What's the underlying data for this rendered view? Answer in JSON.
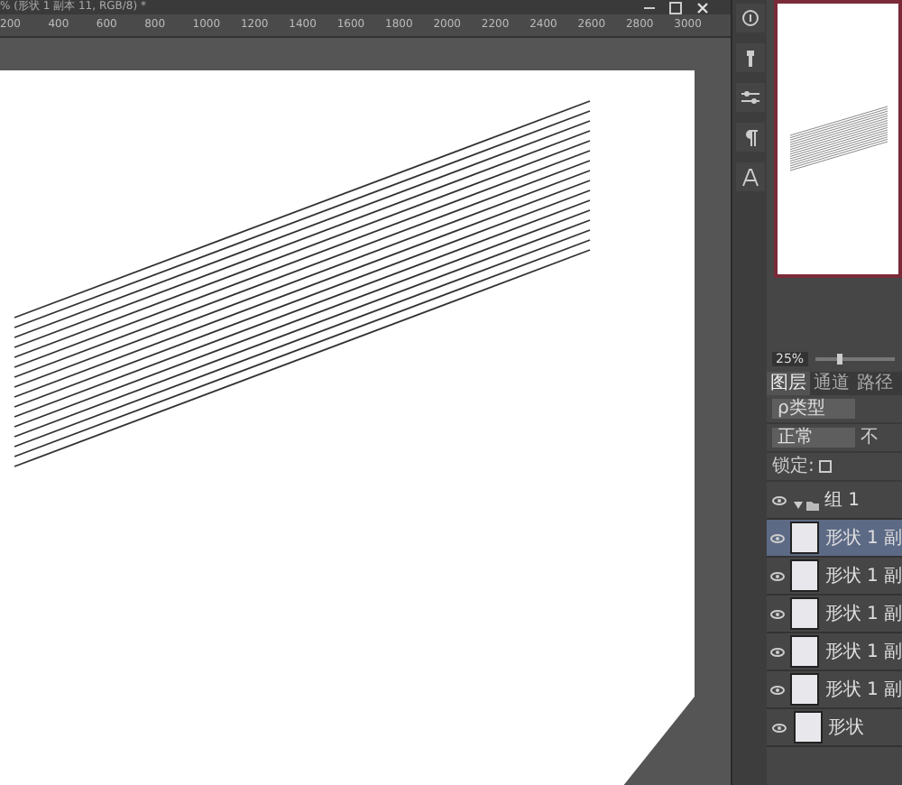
{
  "document": {
    "title": "% (形状 1 副本 11, RGB/8) *",
    "ruler_labels": [
      "200",
      "400",
      "600",
      "800",
      "1000",
      "1200",
      "1400",
      "1600",
      "1800",
      "2000",
      "2200",
      "2400",
      "2600",
      "2800",
      "3000"
    ]
  },
  "navigator": {
    "zoom": "25%",
    "level": 0.3
  },
  "layers_panel": {
    "tabs": [
      {
        "label": "图层",
        "selected": true
      },
      {
        "label": "通道",
        "selected": false
      },
      {
        "label": "路径",
        "selected": false
      }
    ],
    "filter": "ρ类型",
    "blend_mode": "正常",
    "opacity_label": "不",
    "lock_label": "锁定:",
    "layers": [
      {
        "name": "组 1",
        "kind": "group",
        "expanded": true,
        "visible": true,
        "selected": false,
        "children": [
          {
            "name": "形状 1 副",
            "kind": "shape",
            "visible": true,
            "selected": true
          },
          {
            "name": "形状 1 副",
            "kind": "shape",
            "visible": true,
            "selected": false
          },
          {
            "name": "形状 1 副",
            "kind": "shape",
            "visible": true,
            "selected": false
          },
          {
            "name": "形状 1 副",
            "kind": "shape",
            "visible": true,
            "selected": false
          },
          {
            "name": "形状 1 副",
            "kind": "shape",
            "visible": true,
            "selected": false
          },
          {
            "name": "形状",
            "kind": "shape",
            "visible": true,
            "selected": false
          }
        ]
      }
    ]
  }
}
